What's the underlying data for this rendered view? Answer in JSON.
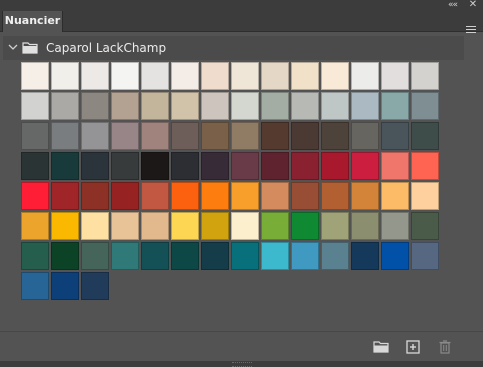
{
  "window": {
    "collapse_glyph": "««",
    "close_glyph": "✕"
  },
  "panel": {
    "tab_title": "Nuancier",
    "menu_icon": "hamburger-menu-icon"
  },
  "group": {
    "name": "Caparol LackChamp",
    "expanded": true,
    "icons": [
      "chevron-down-icon",
      "folder-icon"
    ]
  },
  "swatches": [
    "#f6efe7",
    "#f0efea",
    "#ede9e6",
    "#f4f4f2",
    "#e4e3e1",
    "#f3ece7",
    "#efdccd",
    "#efe6d8",
    "#e4d7c6",
    "#f1e1c9",
    "#f9ead7",
    "#ececea",
    "#e1dedd",
    "#d4d2ce",
    "#d2d2d0",
    "#aaa9a5",
    "#8c8780",
    "#b3a192",
    "#c3b59b",
    "#d0c3a9",
    "#cdc5bd",
    "#d3d7cf",
    "#a3ada4",
    "#b6b9b4",
    "#bfc6c6",
    "#aab9c2",
    "#89a8a8",
    "#7e8e92",
    "#666767",
    "#7a7d80",
    "#949496",
    "#978587",
    "#a0837c",
    "#6e5e5a",
    "#7a6049",
    "#907b65",
    "#553a30",
    "#4b3934",
    "#4e433a",
    "#666560",
    "#49555a",
    "#3f4d4a",
    "#2a3434",
    "#183a3a",
    "#2b333b",
    "#373b3b",
    "#1c1818",
    "#2d2e34",
    "#372b38",
    "#693a47",
    "#5f2330",
    "#8a2130",
    "#a8192d",
    "#cc1e3e",
    "#f0766c",
    "#fe6451",
    "#ff1e35",
    "#9f2528",
    "#8d3126",
    "#962322",
    "#c25842",
    "#fc6110",
    "#fd7d0e",
    "#f89e2b",
    "#d48b5d",
    "#974e35",
    "#b25f32",
    "#d48438",
    "#fcbb66",
    "#fdd09e",
    "#eda42c",
    "#fbb800",
    "#fde0a2",
    "#e8c397",
    "#e2b98c",
    "#fdd654",
    "#d1a40f",
    "#fcefce",
    "#78ae38",
    "#0f8a32",
    "#a0a277",
    "#8b8e6f",
    "#94988c",
    "#4b5b4a",
    "#255e4d",
    "#0c4226",
    "#45655a",
    "#2f7979",
    "#145156",
    "#0d4746",
    "#153d49",
    "#07707b",
    "#3db9ce",
    "#3f99c0",
    "#5a8190",
    "#14395b",
    "#0151a9",
    "#566782",
    "#276596",
    "#0d3f78",
    "#213c5b"
  ],
  "toolbar": {
    "buttons": [
      {
        "name": "new-group-button",
        "icon": "folder-icon"
      },
      {
        "name": "new-swatch-button",
        "icon": "add-square-icon"
      },
      {
        "name": "delete-button",
        "icon": "trash-icon",
        "disabled": true
      }
    ]
  },
  "colors": {
    "panel_bg": "#535353",
    "header_bg": "#3c3c3c",
    "group_bg": "#4b4b4b",
    "text": "#ececec"
  }
}
